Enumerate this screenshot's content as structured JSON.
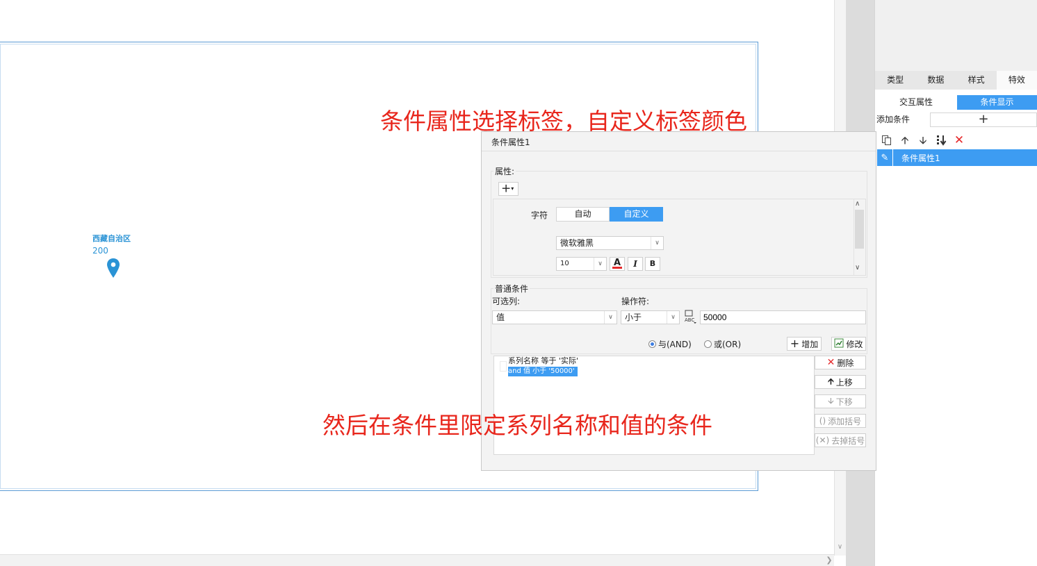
{
  "annotations": {
    "first": "条件属性选择标签，自定义标签颜色",
    "second": "然后在条件里限定系列名称和值的条件"
  },
  "map": {
    "label_name": "西藏自治区",
    "label_value": "200",
    "pin_color": "#2a93d5"
  },
  "right_panel": {
    "tabs": [
      {
        "label": "类型"
      },
      {
        "label": "数据"
      },
      {
        "label": "样式"
      },
      {
        "label": "特效"
      }
    ],
    "active_tab": "特效",
    "subtabs": [
      {
        "label": "交互属性"
      },
      {
        "label": "条件显示"
      }
    ],
    "active_subtab": "条件显示",
    "add_condition_label": "添加条件",
    "add_button": "+",
    "toolbar_icons": [
      "copy-icon",
      "arrow-up-icon",
      "arrow-down-icon",
      "move-bottom-icon",
      "delete-icon"
    ],
    "list_items": [
      {
        "label": "条件属性1"
      }
    ]
  },
  "dialog": {
    "title": "条件属性1",
    "attributes": {
      "group_label": "属性:",
      "add_button": "+",
      "char_label": "字符",
      "mode_auto": "自动",
      "mode_custom": "自定义",
      "selected_mode": "自定义",
      "font": "微软雅黑",
      "font_size": "10",
      "color_button": "A",
      "italic_button": "I",
      "bold_button": "B"
    },
    "condition": {
      "group_label": "普通条件",
      "column_label": "可选列:",
      "operator_label": "操作符:",
      "column_value": "值",
      "operator_value": "小于",
      "value": "50000",
      "and_label": "与(AND)",
      "or_label": "或(OR)",
      "selected_logic": "and",
      "add_button": "增加",
      "modify_button": "修改",
      "list": [
        "系列名称 等于 '实际'",
        "and 值 小于 '50000'"
      ],
      "delete_button": "删除",
      "up_button": "上移",
      "down_button": "下移",
      "add_bracket_button": "添加括号",
      "remove_bracket_button": "去掉括号"
    }
  },
  "colors": {
    "accent": "#3d9cf2",
    "annotation": "#e8261c",
    "danger": "#e5292b"
  }
}
